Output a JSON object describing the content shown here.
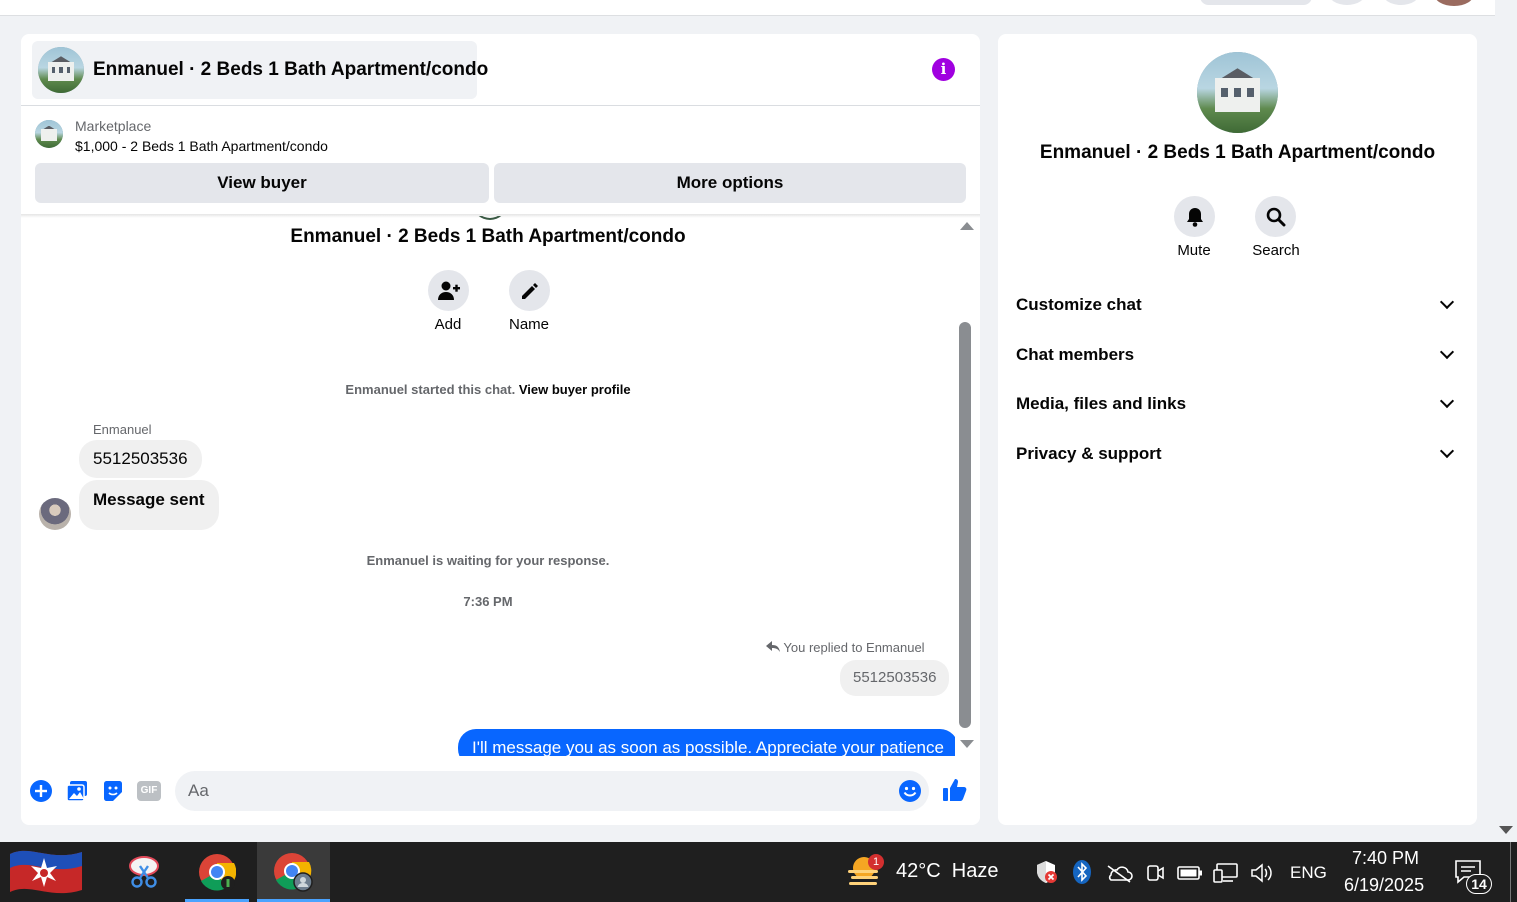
{
  "header": {
    "chat_title": "Enmanuel · 2 Beds 1 Bath Apartment/condo",
    "info_icon": "info-icon"
  },
  "listing": {
    "label": "Marketplace",
    "title": "$1,000 - 2 Beds 1 Bath Apartment/condo"
  },
  "buttons": {
    "view_buyer": "View buyer",
    "more_options": "More options"
  },
  "conversation": {
    "title": "Enmanuel · 2 Beds 1 Bath Apartment/condo",
    "actions": [
      {
        "label": "Add",
        "icon": "add-person-icon"
      },
      {
        "label": "Name",
        "icon": "pencil-icon"
      }
    ],
    "started_text": "Enmanuel started this chat.",
    "view_profile_link": "View buyer profile",
    "sender": "Enmanuel",
    "incoming": [
      "5512503536",
      "Message sent"
    ],
    "waiting_text": "Enmanuel is waiting for your response.",
    "timestamp": "7:36 PM",
    "reply_note": "You replied to Enmanuel",
    "reply_quote": "5512503536",
    "outgoing": "I'll message you as soon as possible. Appreciate your patience"
  },
  "composer": {
    "placeholder": "Aa",
    "tools": [
      "plus-icon",
      "photo-icon",
      "sticker-icon",
      "gif-icon"
    ],
    "gif_label": "GIF",
    "emoji_icon": "emoji-icon",
    "like_icon": "thumbs-up-icon"
  },
  "sidebar": {
    "title": "Enmanuel · 2 Beds 1 Bath Apartment/condo",
    "actions": [
      {
        "label": "Mute",
        "icon": "bell-icon"
      },
      {
        "label": "Search",
        "icon": "search-icon"
      }
    ],
    "sections": [
      "Customize chat",
      "Chat members",
      "Media, files and links",
      "Privacy & support"
    ]
  },
  "taskbar": {
    "weather_badge": "1",
    "weather": "42°C  Haze",
    "language": "ENG",
    "time": "7:40 PM",
    "date": "6/19/2025",
    "notifications": "14"
  },
  "colors": {
    "accent": "#0866ff",
    "info": "#a000e0",
    "panel_bg": "#f0f2f5"
  }
}
